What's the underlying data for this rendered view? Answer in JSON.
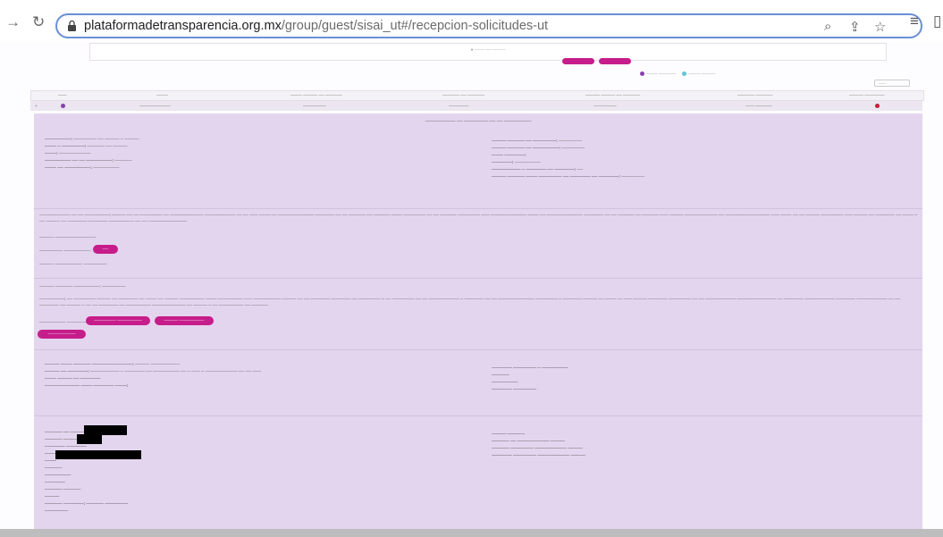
{
  "browser": {
    "url_domain": "plataformadetransparencia.org.mx",
    "url_path": "/group/guest/sisai_ut#/recepcion-solicitudes-ut"
  }
}
